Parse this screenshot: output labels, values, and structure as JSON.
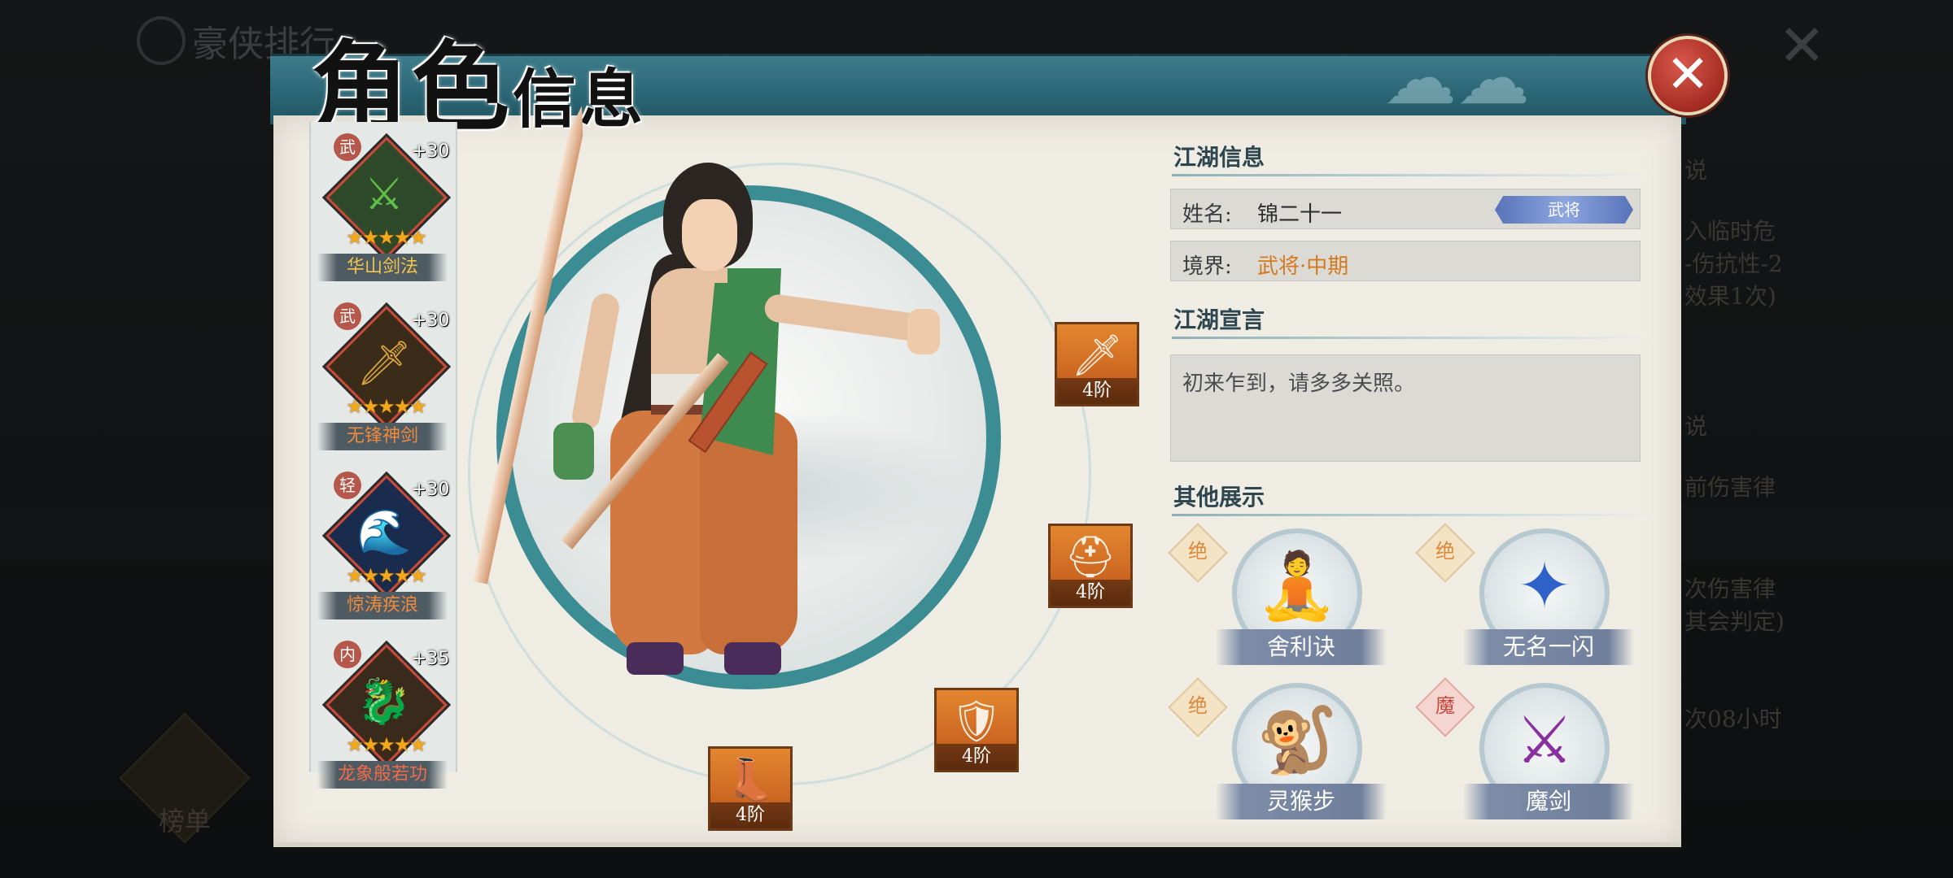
{
  "background": {
    "title": "豪侠排行",
    "side_lines": [
      "说",
      "入临时危",
      "-伤抗性-2",
      "效果1次)",
      "说",
      "前伤害律",
      "次伤害律",
      "其会判定)",
      "次08小时"
    ],
    "rank_label": "榜单"
  },
  "dialog": {
    "title_big": "角色",
    "title_small": "信息",
    "close_symbol": "✕"
  },
  "skills": [
    {
      "tag": "武",
      "bonus": "+30",
      "stars": "★★★★★",
      "name": "华山剑法",
      "name_color": "#f3c54a",
      "art": "⚔",
      "art_color": "#5fbf48",
      "bg": "#2f4a2a"
    },
    {
      "tag": "武",
      "bonus": "+30",
      "stars": "★★★★★",
      "name": "无锋神剑",
      "name_color": "#f08a3c",
      "art": "🗡",
      "art_color": "#d9a441",
      "bg": "#3a2c18"
    },
    {
      "tag": "轻",
      "bonus": "+30",
      "stars": "★★★★★",
      "name": "惊涛疾浪",
      "name_color": "#f08a3c",
      "art": "🌊",
      "art_color": "#3f7fd6",
      "bg": "#1a2c4e"
    },
    {
      "tag": "内",
      "bonus": "+35",
      "stars": "★★★★★",
      "name": "龙象般若功",
      "name_color": "#f06b4a",
      "art": "🐉",
      "art_color": "#c9a36a",
      "bg": "#3a2a1c"
    }
  ],
  "equipment": [
    {
      "slot": "weapon",
      "icon": "🗡",
      "grade": "4阶",
      "rarity": "orange"
    },
    {
      "slot": "helmet",
      "icon": "⛑",
      "grade": "4阶",
      "rarity": "orange"
    },
    {
      "slot": "armor",
      "icon": "🛡",
      "grade": "4阶",
      "rarity": "orange"
    },
    {
      "slot": "boots",
      "icon": "👢",
      "grade": "4阶",
      "rarity": "purple"
    }
  ],
  "info": {
    "section_jianghu": "江湖信息",
    "name_label": "姓名:",
    "name_value": "锦二十一",
    "rank_badge": "武将",
    "realm_label": "境界:",
    "realm_value": "武将·中期",
    "section_motto": "江湖宣言",
    "motto": "初来乍到，请多多关照。",
    "section_extra": "其他展示"
  },
  "extras": [
    {
      "badge": "绝",
      "badge_type": "normal",
      "name": "舍利诀",
      "glyph": "🧘",
      "glyph_color": "#7a2f9c"
    },
    {
      "badge": "绝",
      "badge_type": "normal",
      "name": "无名一闪",
      "glyph": "✦",
      "glyph_color": "#2f62c8"
    },
    {
      "badge": "绝",
      "badge_type": "normal",
      "name": "灵猴步",
      "glyph": "🐒",
      "glyph_color": "#5a4420"
    },
    {
      "badge": "魔",
      "badge_type": "red",
      "name": "魔剑",
      "glyph": "⚔",
      "glyph_color": "#8a2fa0"
    }
  ]
}
